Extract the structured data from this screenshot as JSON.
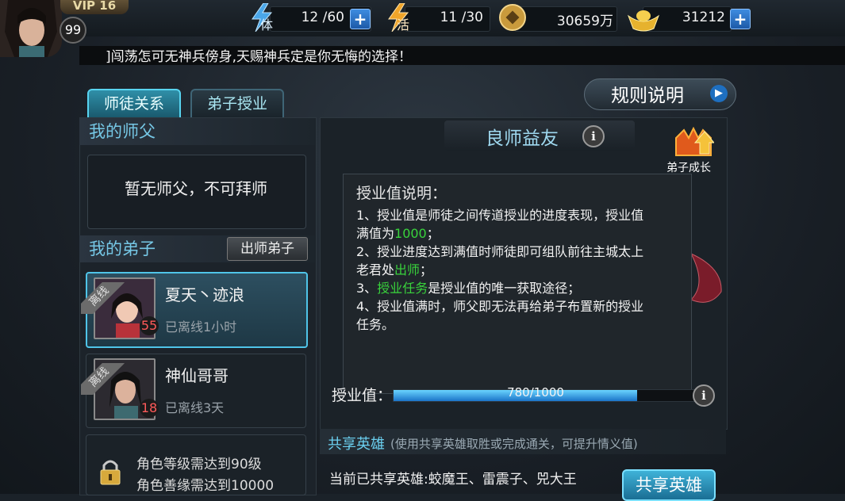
{
  "player": {
    "vip": "VIP 16",
    "level": "99"
  },
  "resources": [
    {
      "icon": "stamina-icon",
      "label": "体",
      "value": "12 /60"
    },
    {
      "icon": "vitality-icon",
      "label": "活",
      "value": "11 /30"
    },
    {
      "icon": "coin-icon",
      "value": "30659万"
    },
    {
      "icon": "gold-ingot-icon",
      "value": "31212"
    }
  ],
  "marquee": "]闯荡怎可无神兵傍身,天赐神兵定是你无悔的选择！",
  "tabs": [
    {
      "label": "师徒关系",
      "active": true
    },
    {
      "label": "弟子授业",
      "active": false
    }
  ],
  "rules_button": "规则说明",
  "left": {
    "my_master_title": "我的师父",
    "no_master_text": "暂无师父，不可拜师",
    "my_disciples_title": "我的弟子",
    "graduate_button": "出师弟子",
    "disciples": [
      {
        "name": "夏天丶迹浪",
        "level": "55",
        "status": "已离线1小时",
        "tag": "离线"
      },
      {
        "name": "神仙哥哥",
        "level": "18",
        "status": "已离线3天",
        "tag": "离线"
      }
    ],
    "locked_slot": {
      "line1": "角色等级需达到90级",
      "line2": "角色善缘需达到10000"
    }
  },
  "right": {
    "title": "良师益友",
    "growth_label": "弟子成长",
    "tooltip": {
      "title": "授业值说明：",
      "line1a": "1、授业值是师徒之间传道授业的进度表现，授业值",
      "line1b_pre": "满值为",
      "line1b_green": "1000",
      "line1b_post": "；",
      "line2a": "2、授业进度达到满值时师徒即可组队前往主城太上",
      "line2b_pre": "老君处",
      "line2b_green": "出师",
      "line2b_post": "；",
      "line3_pre": "3、",
      "line3_green": "授业任务",
      "line3_post": "是授业值的唯一获取途径；",
      "line4a": "4、授业值满时，师父即无法再给弟子布置新的授业",
      "line4b": "任务。"
    },
    "progress": {
      "label": "授业值：",
      "text": "780/1000",
      "value": 780,
      "max": 1000
    },
    "share": {
      "title": "共享英雄",
      "subtitle": "(使用共享英雄取胜或完成通关，可提升情义值)",
      "current": "当前已共享英雄:蛟魔王、雷震子、兕大王",
      "button": "共享英雄"
    }
  }
}
